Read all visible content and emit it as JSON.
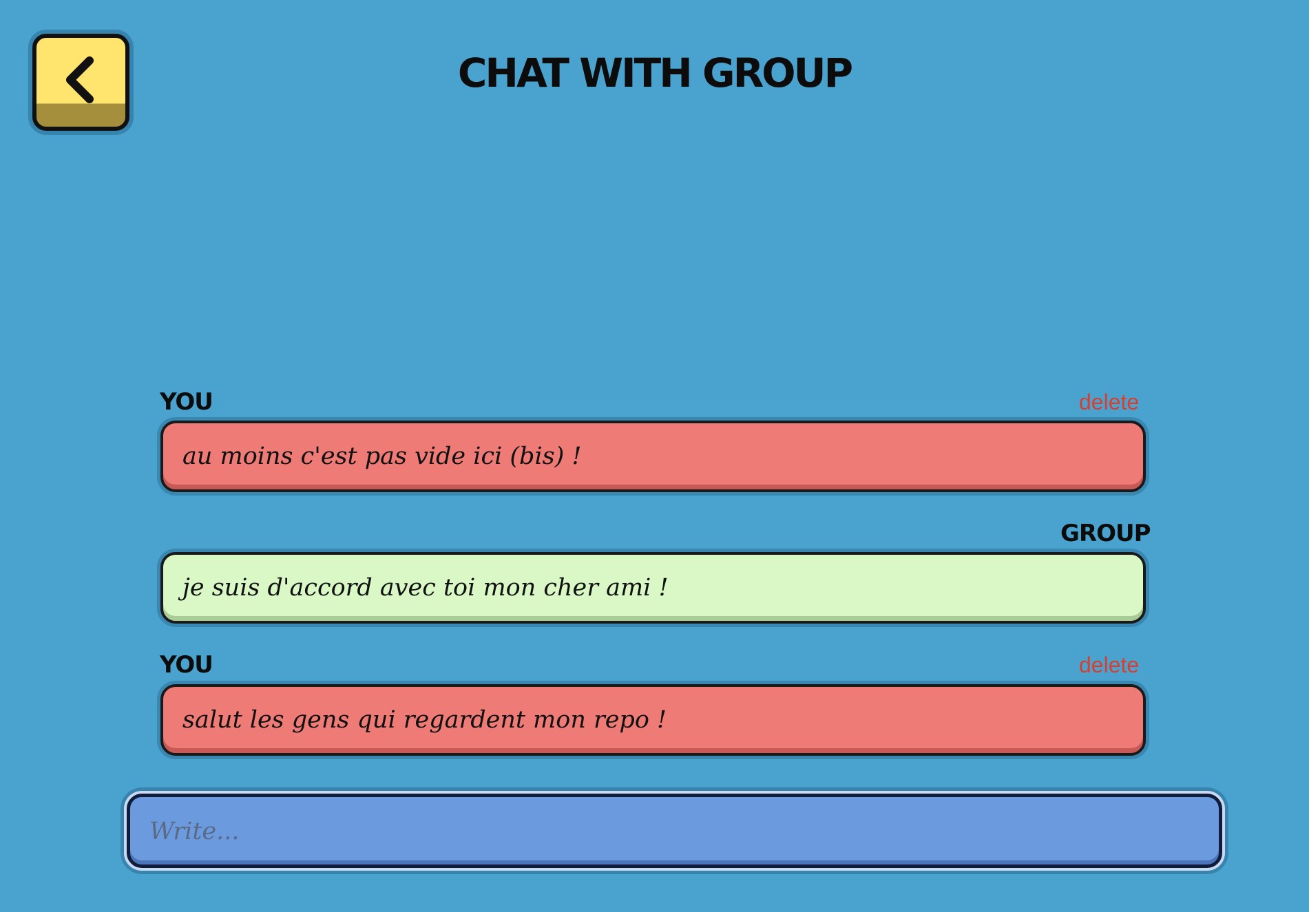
{
  "header": {
    "title": "CHAT WITH GROUP",
    "back_icon": "chevron-left-icon"
  },
  "messages": [
    {
      "sender": "YOU",
      "text": "au moins c'est pas vide ici (bis) !",
      "delete_label": "delete"
    },
    {
      "sender": "GROUP",
      "text": "je suis d'accord avec toi mon cher ami !"
    },
    {
      "sender": "YOU",
      "text": "salut les gens qui regardent mon repo !",
      "delete_label": "delete"
    }
  ],
  "composer": {
    "placeholder": "Write...",
    "value": ""
  },
  "colors": {
    "background": "#4aa3cf",
    "own_bubble": "#ee7b76",
    "group_bubble": "#d9f8c6",
    "back_button": "#ffe46e",
    "delete_link": "#d93e2f",
    "composer": "#6b9bde"
  }
}
